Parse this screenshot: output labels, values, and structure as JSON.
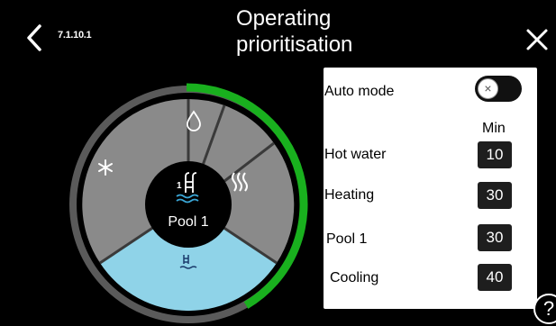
{
  "header": {
    "menu_code": "7.1.10.1",
    "title_line1": "Operating",
    "title_line2": "prioritisation"
  },
  "dial": {
    "center_label": "Pool 1",
    "center_number": "1",
    "segments": [
      "hot-water",
      "heating",
      "pool",
      "cooling"
    ],
    "colors": {
      "segment": "#8a8a8a",
      "active_segment": "#8fd3e8",
      "ring": "#5a5a5a",
      "progress": "#19b01e"
    }
  },
  "panel": {
    "auto_mode_label": "Auto mode",
    "auto_mode_on": false,
    "toggle_glyph": "×",
    "unit_header": "Min",
    "rows": [
      {
        "label": "Hot water",
        "value": "10"
      },
      {
        "label": "Heating",
        "value": "30"
      },
      {
        "label": "Pool 1",
        "value": "30"
      },
      {
        "label": "Cooling",
        "value": "40"
      }
    ]
  },
  "help": {
    "glyph": "?"
  }
}
